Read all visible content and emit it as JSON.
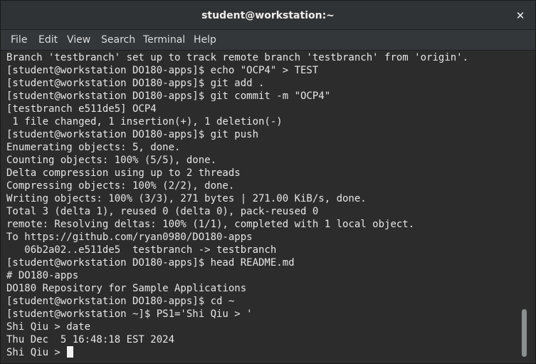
{
  "window": {
    "title": "student@workstation:~",
    "close_label": "✕"
  },
  "menubar": {
    "items": [
      "File",
      "Edit",
      "View",
      "Search",
      "Terminal",
      "Help"
    ]
  },
  "terminal": {
    "lines": [
      "Branch 'testbranch' set up to track remote branch 'testbranch' from 'origin'.",
      "[student@workstation DO180-apps]$ echo \"OCP4\" > TEST",
      "[student@workstation DO180-apps]$ git add .",
      "[student@workstation DO180-apps]$ git commit -m \"OCP4\"",
      "[testbranch e511de5] OCP4",
      " 1 file changed, 1 insertion(+), 1 deletion(-)",
      "[student@workstation DO180-apps]$ git push",
      "Enumerating objects: 5, done.",
      "Counting objects: 100% (5/5), done.",
      "Delta compression using up to 2 threads",
      "Compressing objects: 100% (2/2), done.",
      "Writing objects: 100% (3/3), 271 bytes | 271.00 KiB/s, done.",
      "Total 3 (delta 1), reused 0 (delta 0), pack-reused 0",
      "remote: Resolving deltas: 100% (1/1), completed with 1 local object.",
      "To https://github.com/ryan0980/DO180-apps",
      "   06b2a02..e511de5  testbranch -> testbranch",
      "[student@workstation DO180-apps]$ head README.md",
      "# DO180-apps",
      "DO180 Repository for Sample Applications",
      "[student@workstation DO180-apps]$ cd ~",
      "[student@workstation ~]$ PS1='Shi Qiu > '",
      "Shi Qiu > date",
      "Thu Dec  5 16:48:18 EST 2024"
    ],
    "prompt": "Shi Qiu > "
  }
}
